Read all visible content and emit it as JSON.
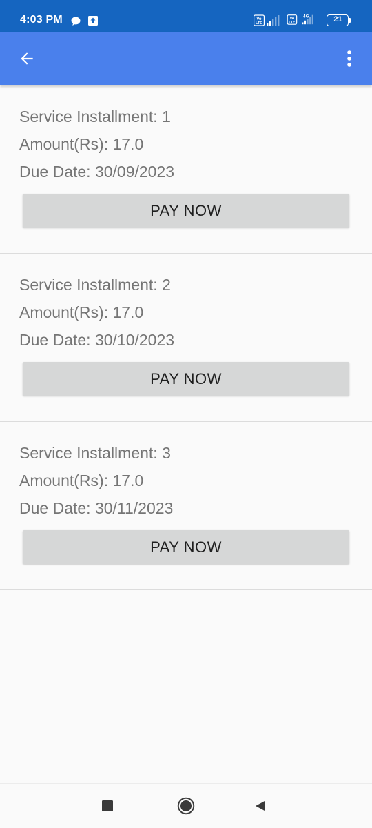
{
  "status_bar": {
    "time": "4:03 PM",
    "battery_level": "21",
    "network_label": "4G",
    "volte_label": "Vo LTE"
  },
  "app_bar": {
    "back_icon": "arrow-back-icon",
    "menu_icon": "more-vert-icon"
  },
  "installments": [
    {
      "label": "Service Installment: 1",
      "amount": "Amount(Rs): 17.0",
      "due_date": "Due Date: 30/09/2023",
      "button": "PAY NOW"
    },
    {
      "label": "Service Installment: 2",
      "amount": "Amount(Rs): 17.0",
      "due_date": "Due Date: 30/10/2023",
      "button": "PAY NOW"
    },
    {
      "label": "Service Installment: 3",
      "amount": "Amount(Rs): 17.0",
      "due_date": "Due Date: 30/11/2023",
      "button": "PAY NOW"
    }
  ],
  "nav_bar": {
    "recents_icon": "square-recents-icon",
    "home_icon": "circle-home-icon",
    "back_icon": "triangle-back-icon"
  },
  "colors": {
    "status_bar": "#1565c0",
    "app_bar": "#4a80ec",
    "button_bg": "#d6d7d7",
    "text_secondary": "#757575"
  }
}
